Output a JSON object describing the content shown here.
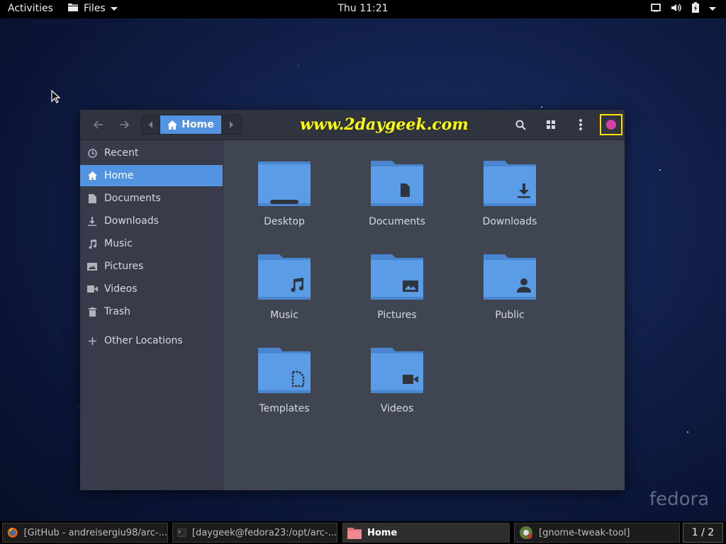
{
  "topbar": {
    "activities": "Activities",
    "app_menu": "Files",
    "clock": "Thu 11:21"
  },
  "window": {
    "path_current": "Home",
    "watermark": "www.2daygeek.com"
  },
  "sidebar": {
    "items": [
      {
        "label": "Recent",
        "icon": "clock-icon"
      },
      {
        "label": "Home",
        "icon": "home-icon",
        "active": true
      },
      {
        "label": "Documents",
        "icon": "document-icon"
      },
      {
        "label": "Downloads",
        "icon": "download-icon"
      },
      {
        "label": "Music",
        "icon": "music-icon"
      },
      {
        "label": "Pictures",
        "icon": "picture-icon"
      },
      {
        "label": "Videos",
        "icon": "video-icon"
      },
      {
        "label": "Trash",
        "icon": "trash-icon"
      },
      {
        "label": "Other Locations",
        "icon": "plus-icon"
      }
    ]
  },
  "folders": [
    {
      "label": "Desktop",
      "icon": "desktop-folder-icon"
    },
    {
      "label": "Documents",
      "icon": "documents-folder-icon"
    },
    {
      "label": "Downloads",
      "icon": "downloads-folder-icon"
    },
    {
      "label": "Music",
      "icon": "music-folder-icon"
    },
    {
      "label": "Pictures",
      "icon": "pictures-folder-icon"
    },
    {
      "label": "Public",
      "icon": "public-folder-icon"
    },
    {
      "label": "Templates",
      "icon": "templates-folder-icon"
    },
    {
      "label": "Videos",
      "icon": "videos-folder-icon"
    }
  ],
  "taskbar": {
    "tasks": [
      {
        "label": "[GitHub - andreisergiu98/arc-...",
        "icon": "firefox-icon"
      },
      {
        "label": "[daygeek@fedora23:/opt/arc-...",
        "icon": "terminal-icon"
      },
      {
        "label": "Home",
        "icon": "files-icon",
        "active": true
      },
      {
        "label": "[gnome-tweak-tool]",
        "icon": "tweak-tool-icon"
      }
    ],
    "workspace": "1 / 2"
  },
  "desktop": {
    "logo": "fedora"
  },
  "colors": {
    "accent": "#5294e2",
    "folder": "#5b9ce6",
    "watermark": "#ffff00",
    "close_button": "#d63fa3"
  }
}
